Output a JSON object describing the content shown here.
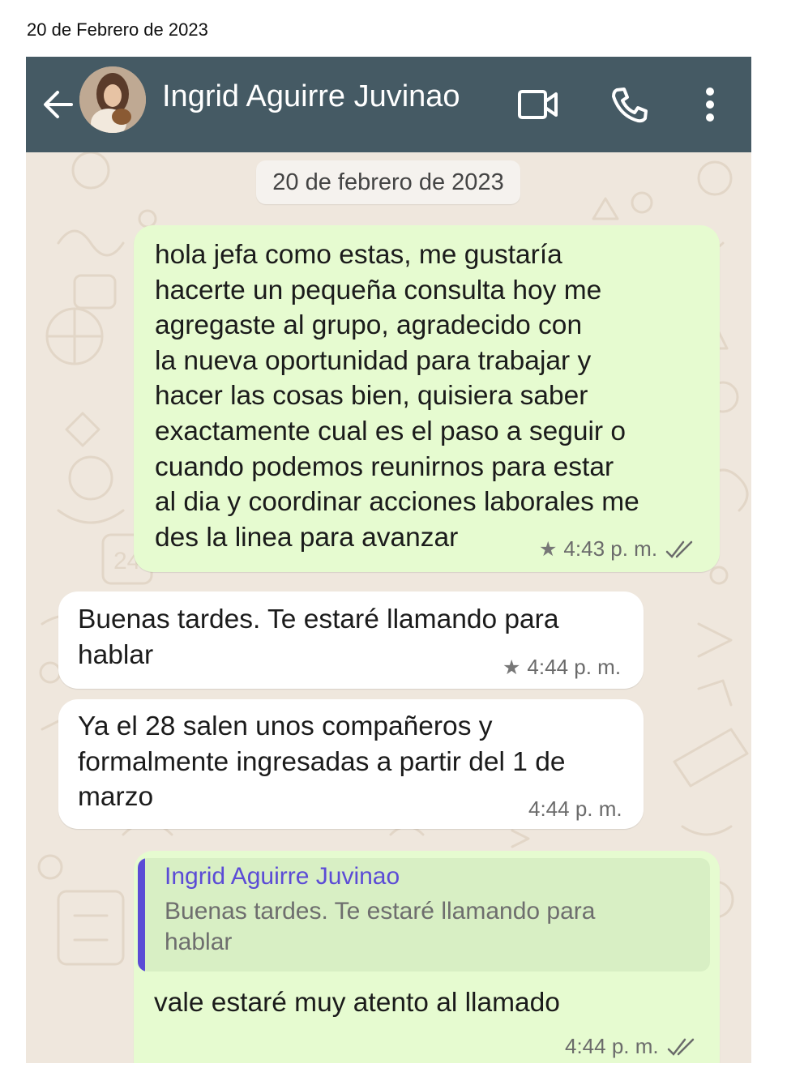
{
  "document": {
    "date": "20 de Febrero de 2023"
  },
  "header": {
    "contact_name": "Ingrid Aguirre Juvinao",
    "background_color": "#455a64",
    "icons": [
      "back-arrow-icon",
      "avatar",
      "video-call-icon",
      "phone-icon",
      "more-options-icon"
    ]
  },
  "chat": {
    "date_chip": "20 de febrero de 2023",
    "colors": {
      "outgoing_bubble": "#e6fbd0",
      "incoming_bubble": "#ffffff",
      "wallpaper": "#efe7dd",
      "quote_accent": "#5b4bd6"
    },
    "messages": [
      {
        "direction": "outgoing",
        "text": "hola jefa como estas, me gustaría\nhacerte un pequeña consulta hoy me\nagregaste al grupo, agradecido con\nla nueva oportunidad para trabajar y\nhacer las cosas bien, quisiera saber\nexactamente cual es el paso a seguir o\ncuando podemos reunirnos para estar\nal dia y coordinar acciones laborales me\ndes la linea para avanzar",
        "time": "4:43 p. m.",
        "starred": true,
        "status": "read"
      },
      {
        "direction": "incoming",
        "text": "Buenas tardes. Te estaré llamando para\nhablar",
        "time": "4:44 p. m.",
        "starred": true
      },
      {
        "direction": "incoming",
        "text": "Ya el 28 salen unos compañeros y\nformalmente ingresadas a partir del 1 de\nmarzo",
        "time": "4:44 p. m.",
        "starred": false
      },
      {
        "direction": "outgoing",
        "quoted": {
          "author": "Ingrid Aguirre Juvinao",
          "text": "Buenas tardes. Te estaré llamando para\nhablar"
        },
        "text": "vale estaré muy atento al llamado",
        "time": "4:44 p. m.",
        "starred": false,
        "status": "read"
      }
    ]
  }
}
